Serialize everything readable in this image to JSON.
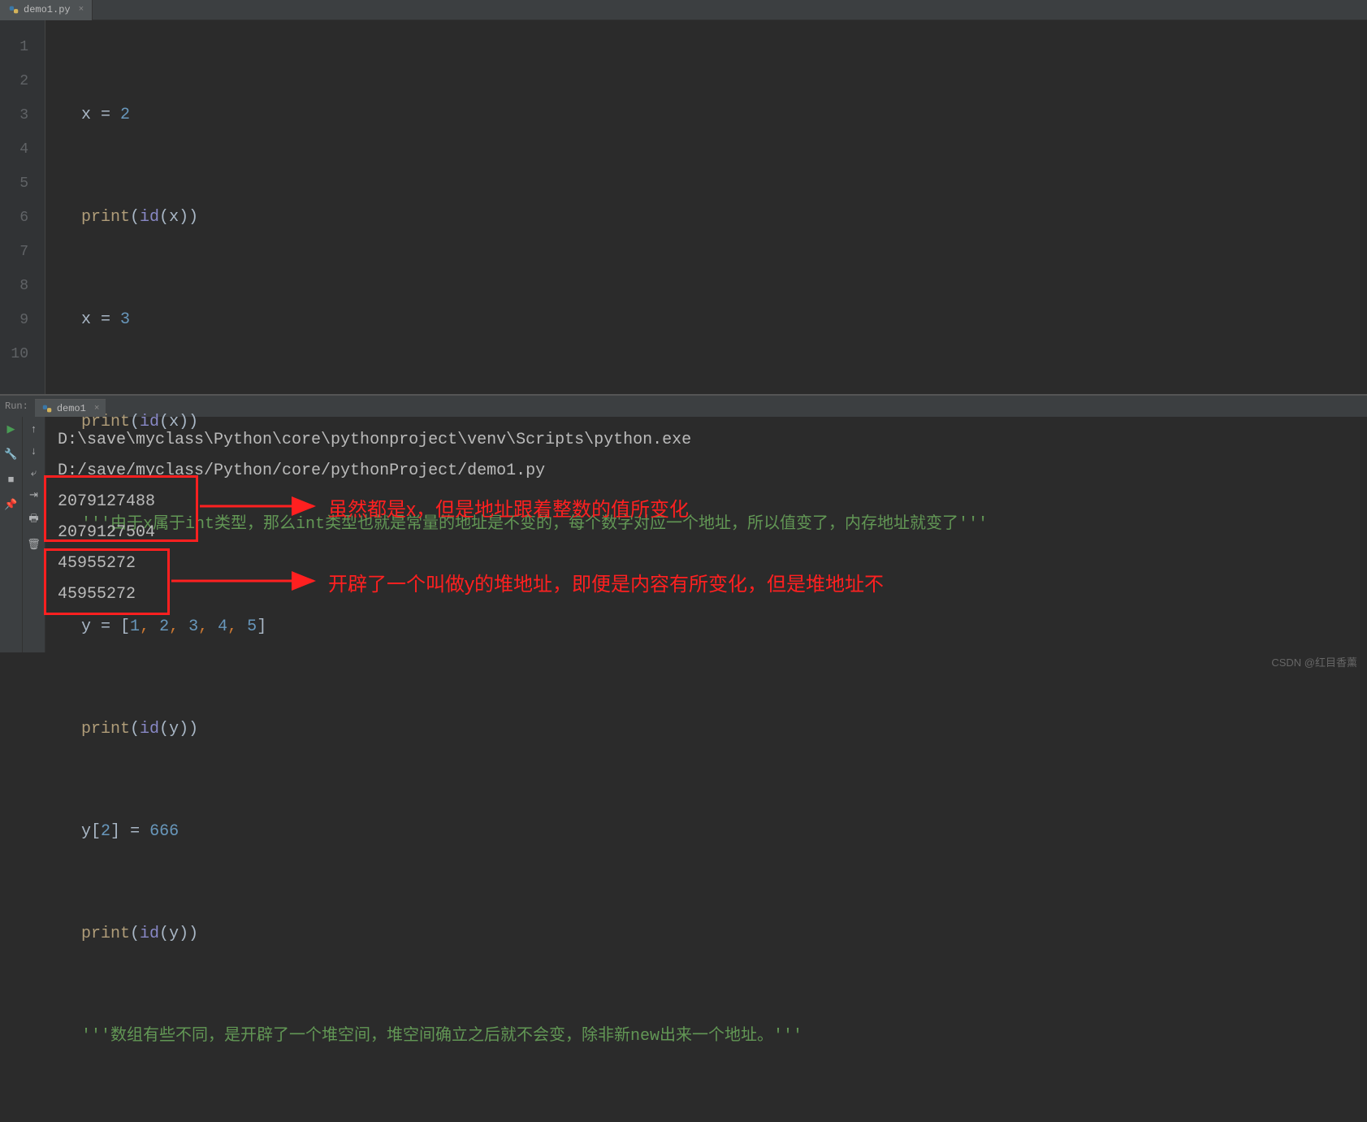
{
  "editor": {
    "tab": {
      "filename": "demo1.py",
      "close": "×"
    },
    "gutter": [
      "1",
      "2",
      "3",
      "4",
      "5",
      "6",
      "7",
      "8",
      "9",
      "10"
    ],
    "code": {
      "l1": {
        "var": "x",
        "op": " = ",
        "num": "2"
      },
      "l2": {
        "fn": "print",
        "p1": "(",
        "builtin": "id",
        "p2": "(",
        "arg": "x",
        "p3": ")",
        "p4": ")"
      },
      "l3": {
        "var": "x",
        "op": " = ",
        "num": "3"
      },
      "l4": {
        "fn": "print",
        "p1": "(",
        "builtin": "id",
        "p2": "(",
        "arg": "x",
        "p3": ")",
        "p4": ")"
      },
      "l5": {
        "doc_a": "'''由于",
        "doc_x": "x",
        "doc_b": "属于",
        "doc_int1": "int",
        "doc_c": "类型，那么",
        "doc_int2": "int",
        "doc_d": "类型也就是常量的地址是不变的，每个数字对应一个地址，所以值变了，内存地址就变了'''"
      },
      "l6": {
        "var": "y",
        "op": " = ",
        "lb": "[",
        "n1": "1",
        "c": ", ",
        "n2": "2",
        "n3": "3",
        "n4": "4",
        "n5": "5",
        "rb": "]"
      },
      "l7": {
        "fn": "print",
        "p1": "(",
        "builtin": "id",
        "p2": "(",
        "arg": "y",
        "p3": ")",
        "p4": ")"
      },
      "l8": {
        "var": "y",
        "lb": "[",
        "idx": "2",
        "rb": "]",
        "op": " = ",
        "val": "666"
      },
      "l9": {
        "fn": "print",
        "p1": "(",
        "builtin": "id",
        "p2": "(",
        "arg": "y",
        "p3": ")",
        "p4": ")"
      },
      "l10": {
        "doc_a": "'''数组有些不同，是开辟了一个堆空间，堆空间确立之后就不会变，除非新",
        "doc_new": "new",
        "doc_b": "出来一个地址。'''"
      }
    }
  },
  "run": {
    "label": "Run:",
    "tab": "demo1",
    "tab_close": "×",
    "console": {
      "path1": "D:\\save\\myclass\\Python\\core\\pythonproject\\venv\\Scripts\\python.exe",
      "path2": "D:/save/myclass/Python/core/pythonProject/demo1.py",
      "out1": "2079127488",
      "out2": "2079127504",
      "out3": "45955272",
      "out4": "45955272"
    },
    "annotations": {
      "ann1": "虽然都是x，但是地址跟着整数的值所变化",
      "ann2": "开辟了一个叫做y的堆地址，即便是内容有所变化，但是堆地址不"
    }
  },
  "watermark": "CSDN @红目香薰"
}
